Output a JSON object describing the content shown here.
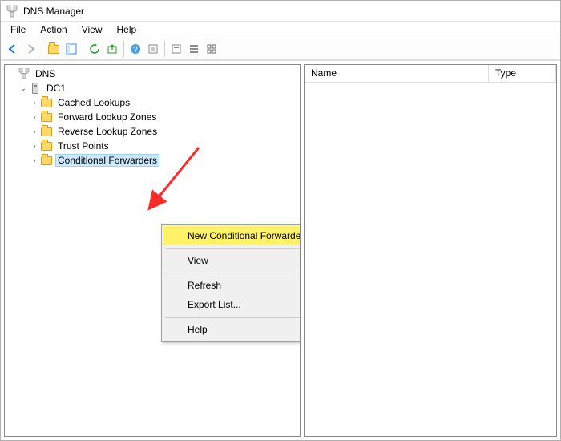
{
  "window": {
    "title": "DNS Manager"
  },
  "menubar": [
    "File",
    "Action",
    "View",
    "Help"
  ],
  "toolbar_icons": [
    "nav-back",
    "nav-forward",
    "folder-up",
    "properties",
    "refresh",
    "export",
    "delete",
    "help-topics",
    "new",
    "view-list",
    "view-details",
    "view-large"
  ],
  "list": {
    "columns": {
      "name": "Name",
      "type": "Type"
    }
  },
  "tree": {
    "root": {
      "label": "DNS"
    },
    "server": {
      "label": "DC1"
    },
    "children": [
      {
        "label": "Cached Lookups"
      },
      {
        "label": "Forward Lookup Zones"
      },
      {
        "label": "Reverse Lookup Zones"
      },
      {
        "label": "Trust Points"
      },
      {
        "label": "Conditional Forwarders",
        "selected": true
      }
    ]
  },
  "context_menu": {
    "new_cond_fwd": "New Conditional Forwarder...",
    "view": "View",
    "refresh": "Refresh",
    "export": "Export List...",
    "help": "Help"
  },
  "annotation": {
    "arrow_color": "#ff2a2a"
  }
}
